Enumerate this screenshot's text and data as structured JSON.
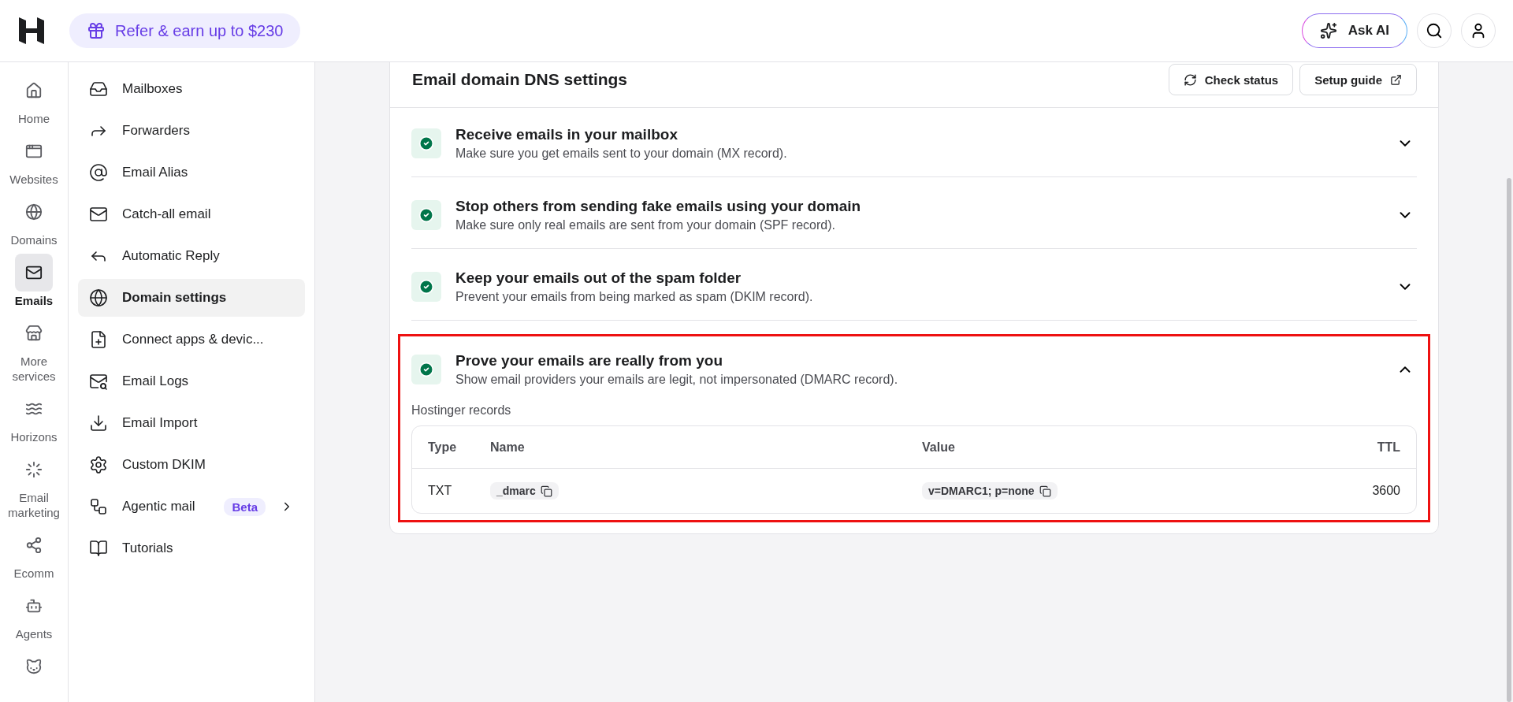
{
  "topbar": {
    "promo": "Refer & earn up to $230",
    "ask_ai": "Ask AI"
  },
  "rail": [
    {
      "label": "Home",
      "selected": false
    },
    {
      "label": "Websites",
      "selected": false
    },
    {
      "label": "Domains",
      "selected": false
    },
    {
      "label": "Emails",
      "selected": true
    },
    {
      "label": "More services",
      "selected": false
    },
    {
      "label": "Horizons",
      "selected": false
    },
    {
      "label": "Email marketing",
      "selected": false
    },
    {
      "label": "Ecomm",
      "selected": false
    },
    {
      "label": "Agents",
      "selected": false
    },
    {
      "selected": false
    }
  ],
  "sidebar": {
    "items": [
      {
        "label": "Mailboxes",
        "selected": false
      },
      {
        "label": "Forwarders",
        "selected": false
      },
      {
        "label": "Email Alias",
        "selected": false
      },
      {
        "label": "Catch-all email",
        "selected": false
      },
      {
        "label": "Automatic Reply",
        "selected": false
      },
      {
        "label": "Domain settings",
        "selected": true
      },
      {
        "label": "Connect apps & devic...",
        "selected": false
      },
      {
        "label": "Email Logs",
        "selected": false
      },
      {
        "label": "Email Import",
        "selected": false
      },
      {
        "label": "Custom DKIM",
        "selected": false
      },
      {
        "label": "Agentic mail",
        "selected": false,
        "badge": "Beta",
        "submenu": true
      },
      {
        "label": "Tutorials",
        "selected": false
      }
    ]
  },
  "card": {
    "title": "Email domain DNS settings",
    "buttons": [
      "Check status",
      "Setup guide"
    ],
    "sections": [
      {
        "title": "Receive emails in your mailbox",
        "description": "Make sure you get emails sent to your domain (MX record).",
        "verified": true,
        "expanded": false,
        "highlighted": false
      },
      {
        "title": "Stop others from sending fake emails using your domain",
        "description": "Make sure only real emails are sent from your domain (SPF record).",
        "verified": true,
        "expanded": false,
        "highlighted": false
      },
      {
        "title": "Keep your emails out of the spam folder",
        "description": "Prevent your emails from being marked as spam (DKIM record).",
        "verified": true,
        "expanded": false,
        "highlighted": false
      },
      {
        "title": "Prove your emails are really from you",
        "description": "Show email providers your emails are legit, not impersonated (DMARC record).",
        "verified": true,
        "expanded": true,
        "highlighted": true,
        "records": {
          "label": "Hostinger records",
          "columns": [
            "Type",
            "Name",
            "Value",
            "TTL"
          ],
          "rows": [
            {
              "cells": [
                {
                  "text": "TXT",
                  "copyable": false
                },
                {
                  "text": "_dmarc",
                  "copyable": true
                },
                {
                  "text": "v=DMARC1; p=none",
                  "copyable": true
                },
                {
                  "text": "3600",
                  "copyable": false
                }
              ]
            }
          ]
        }
      }
    ]
  }
}
